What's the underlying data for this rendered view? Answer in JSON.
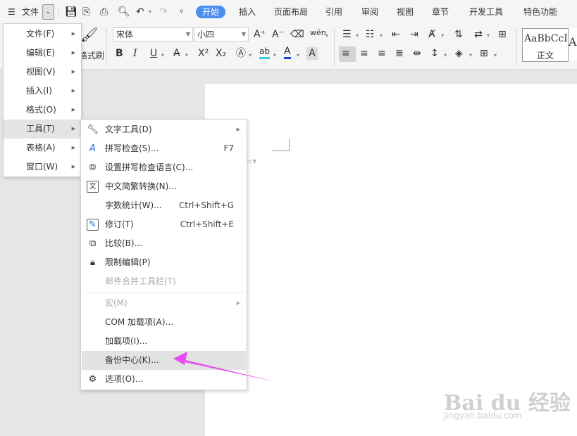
{
  "titlebar": {
    "file_menu": "文件",
    "tabs": [
      "开始",
      "插入",
      "页面布局",
      "引用",
      "审阅",
      "视图",
      "章节",
      "开发工具",
      "特色功能"
    ],
    "active_tab_color": "#4b8ff0"
  },
  "ribbon": {
    "format_painter_label": "格式刷",
    "font_name": "宋体",
    "font_size": "小四",
    "style_preview": "AaBbCcI",
    "style_name": "正文"
  },
  "main_menu": {
    "items": [
      {
        "label": "文件(F)"
      },
      {
        "label": "编辑(E)"
      },
      {
        "label": "视图(V)"
      },
      {
        "label": "插入(I)"
      },
      {
        "label": "格式(O)"
      },
      {
        "label": "工具(T)"
      },
      {
        "label": "表格(A)"
      },
      {
        "label": "窗口(W)"
      }
    ],
    "active_index": 5
  },
  "tools_submenu": {
    "items": [
      {
        "label": "文字工具(D)",
        "icon": "wrench-icon"
      },
      {
        "label": "拼写检查(S)...",
        "shortcut": "F7",
        "icon": "spell-check-icon"
      },
      {
        "label": "设置拼写检查语言(C)...",
        "icon": "globe-icon"
      },
      {
        "label": "中文简繁转换(N)...",
        "icon": "chinese-convert-icon"
      },
      {
        "label": "字数统计(W)...",
        "shortcut": "Ctrl+Shift+G"
      },
      {
        "label": "修订(T)",
        "shortcut": "Ctrl+Shift+E",
        "icon": "track-changes-icon"
      },
      {
        "label": "比较(B)...",
        "icon": "compare-icon"
      },
      {
        "label": "限制编辑(P)",
        "icon": "restrict-edit-icon"
      },
      {
        "label": "邮件合并工具栏(T)",
        "disabled": true
      },
      {
        "label": "宏(M)",
        "disabled": true
      },
      {
        "label": "COM 加载项(A)..."
      },
      {
        "label": "加载项(I)..."
      },
      {
        "label": "备份中心(K)...",
        "highlighted": true
      },
      {
        "label": "选项(O)...",
        "icon": "gear-icon"
      }
    ]
  },
  "annotation": {
    "arrow_color": "#e64cf0"
  },
  "watermark": {
    "brand": "Bai du 经验",
    "url": "jingyan.baidu.com"
  }
}
